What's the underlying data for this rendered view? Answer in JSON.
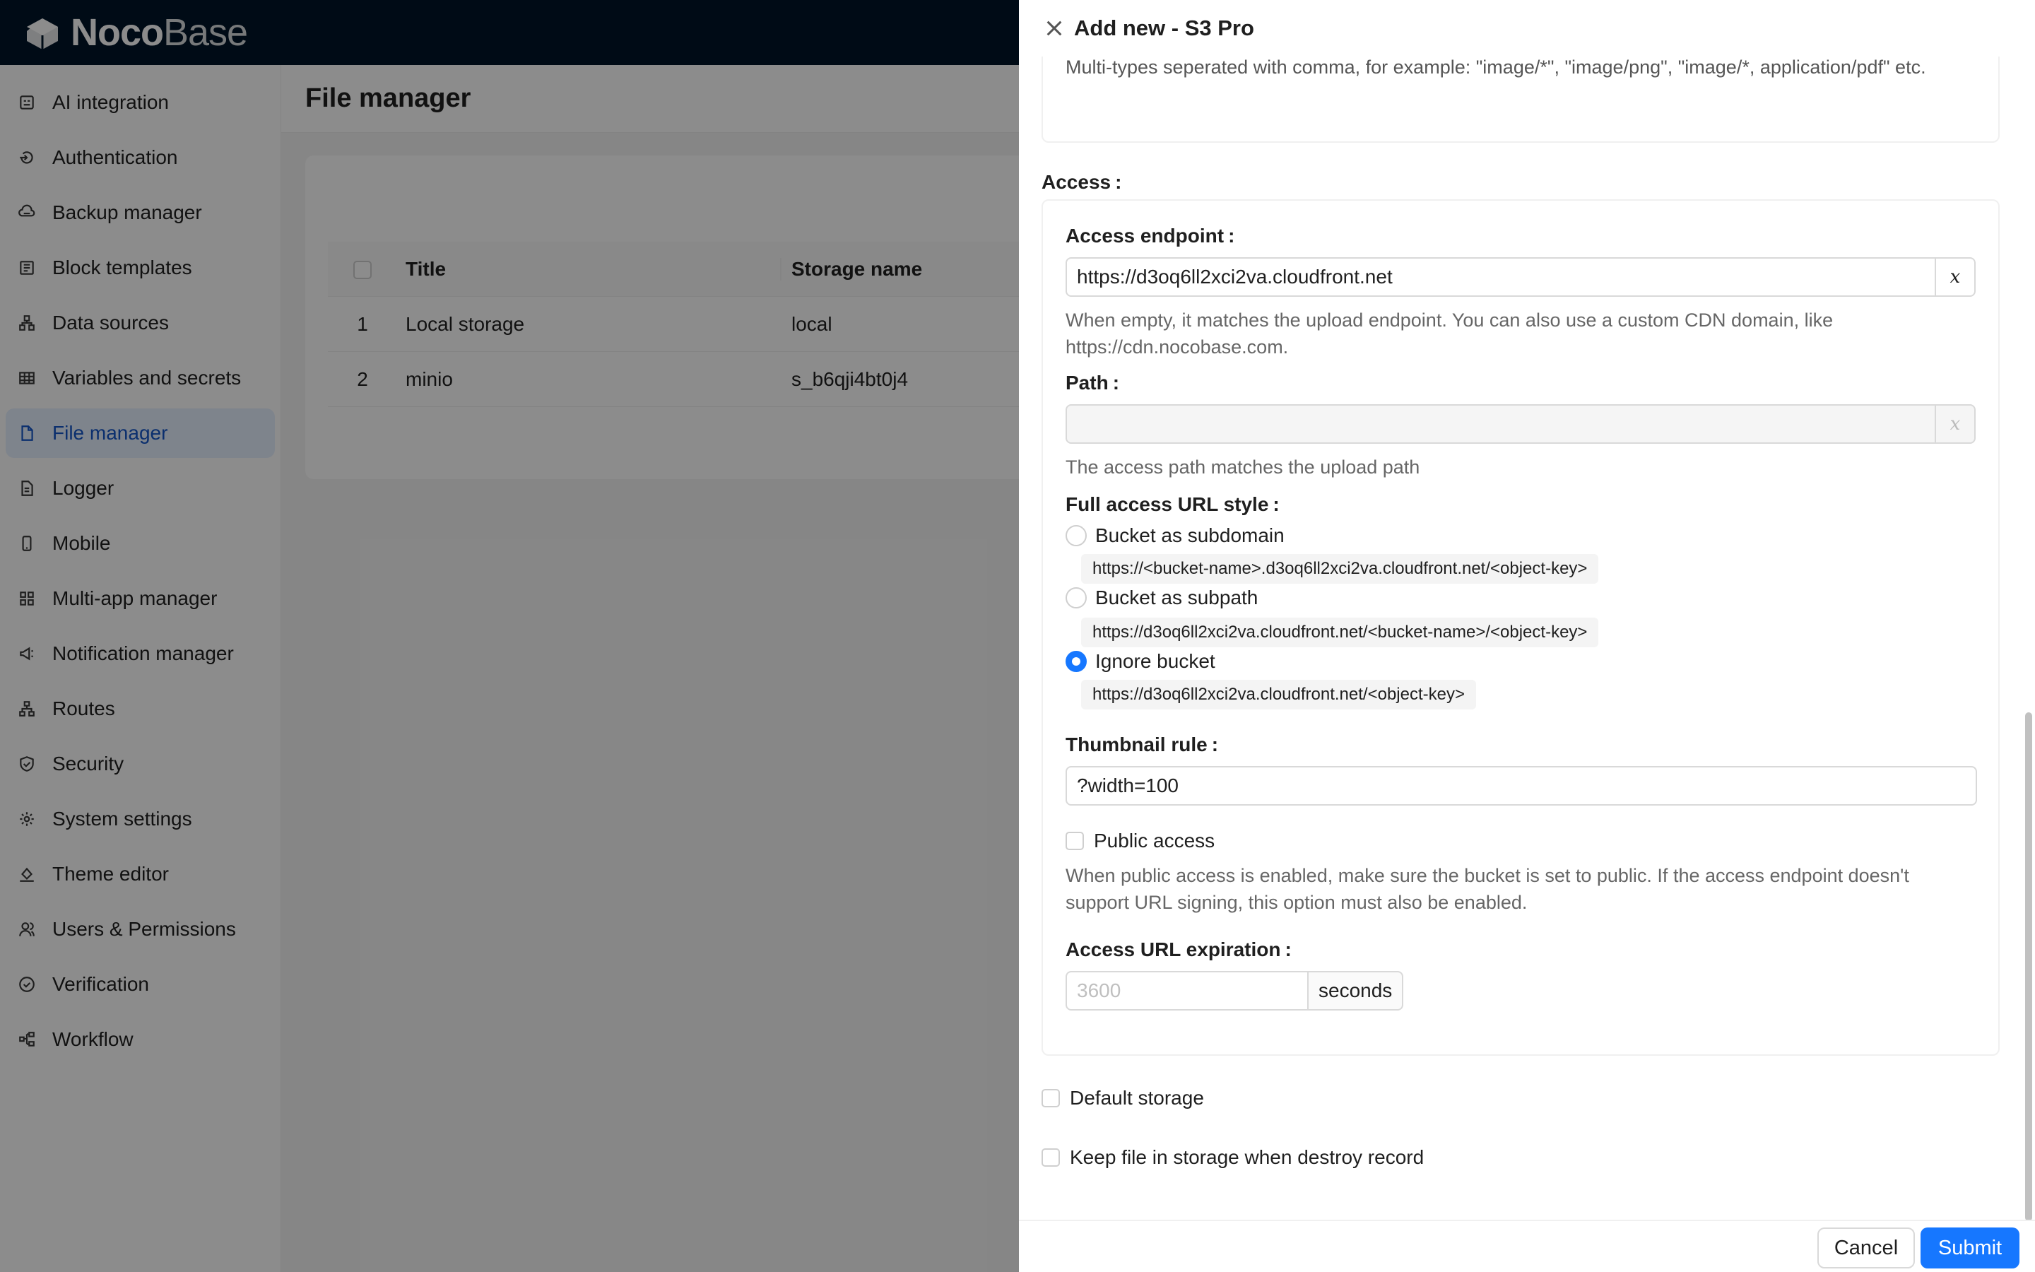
{
  "brand": {
    "bold": "Noco",
    "light": "Base"
  },
  "sidebar": {
    "items": [
      {
        "label": "AI integration",
        "icon": "robot-icon"
      },
      {
        "label": "Authentication",
        "icon": "login-icon"
      },
      {
        "label": "Backup manager",
        "icon": "cloud-server-icon"
      },
      {
        "label": "Block templates",
        "icon": "layout-icon"
      },
      {
        "label": "Data sources",
        "icon": "cluster-icon"
      },
      {
        "label": "Variables and secrets",
        "icon": "table-icon"
      },
      {
        "label": "File manager",
        "icon": "file-icon",
        "active": true
      },
      {
        "label": "Logger",
        "icon": "file-text-icon"
      },
      {
        "label": "Mobile",
        "icon": "mobile-icon"
      },
      {
        "label": "Multi-app manager",
        "icon": "appstore-icon"
      },
      {
        "label": "Notification manager",
        "icon": "notification-icon"
      },
      {
        "label": "Routes",
        "icon": "partition-icon"
      },
      {
        "label": "Security",
        "icon": "safety-icon"
      },
      {
        "label": "System settings",
        "icon": "setting-icon"
      },
      {
        "label": "Theme editor",
        "icon": "bg-colors-icon"
      },
      {
        "label": "Users & Permissions",
        "icon": "team-icon"
      },
      {
        "label": "Verification",
        "icon": "check-circle-icon"
      },
      {
        "label": "Workflow",
        "icon": "workflow-icon"
      }
    ]
  },
  "main": {
    "title": "File manager",
    "table": {
      "headers": {
        "title": "Title",
        "storage_name": "Storage name"
      },
      "rows": [
        {
          "index": "1",
          "title": "Local storage",
          "storage_name": "local"
        },
        {
          "index": "2",
          "title": "minio",
          "storage_name": "s_b6qji4bt0j4"
        }
      ]
    }
  },
  "drawer": {
    "title": "Add new - S3 Pro",
    "mime_help": "Multi-types seperated with comma, for example: \"image/*\", \"image/png\", \"image/*, application/pdf\" etc.",
    "access_label": "Access",
    "access_endpoint": {
      "label": "Access endpoint",
      "value": "https://d3oq6ll2xci2va.cloudfront.net",
      "help": "When empty, it matches the upload endpoint. You can also use a custom CDN domain, like https://cdn.nocobase.com."
    },
    "path": {
      "label": "Path",
      "value": "",
      "help": "The access path matches the upload path"
    },
    "url_style": {
      "label": "Full access URL style",
      "options": [
        {
          "label": "Bucket as subdomain",
          "example": "https://<bucket-name>.d3oq6ll2xci2va.cloudfront.net/<object-key>",
          "checked": false
        },
        {
          "label": "Bucket as subpath",
          "example": "https://d3oq6ll2xci2va.cloudfront.net/<bucket-name>/<object-key>",
          "checked": false
        },
        {
          "label": "Ignore bucket",
          "example": "https://d3oq6ll2xci2va.cloudfront.net/<object-key>",
          "checked": true
        }
      ]
    },
    "thumbnail_rule": {
      "label": "Thumbnail rule",
      "value": "?width=100"
    },
    "public_access": {
      "label": "Public access",
      "help": "When public access is enabled, make sure the bucket is set to public. If the access endpoint doesn't support URL signing, this option must also be enabled."
    },
    "url_expiration": {
      "label": "Access URL expiration",
      "placeholder": "3600",
      "unit": "seconds"
    },
    "default_storage": {
      "label": "Default storage"
    },
    "keep_file": {
      "label": "Keep file in storage when destroy record"
    },
    "var_symbol": "x",
    "colon": ":",
    "cancel_label": "Cancel",
    "submit_label": "Submit"
  },
  "colors": {
    "topbar": "#001529",
    "primary": "#1677ff",
    "active_bg": "#e6f0ff",
    "active_text": "#1456c8"
  }
}
